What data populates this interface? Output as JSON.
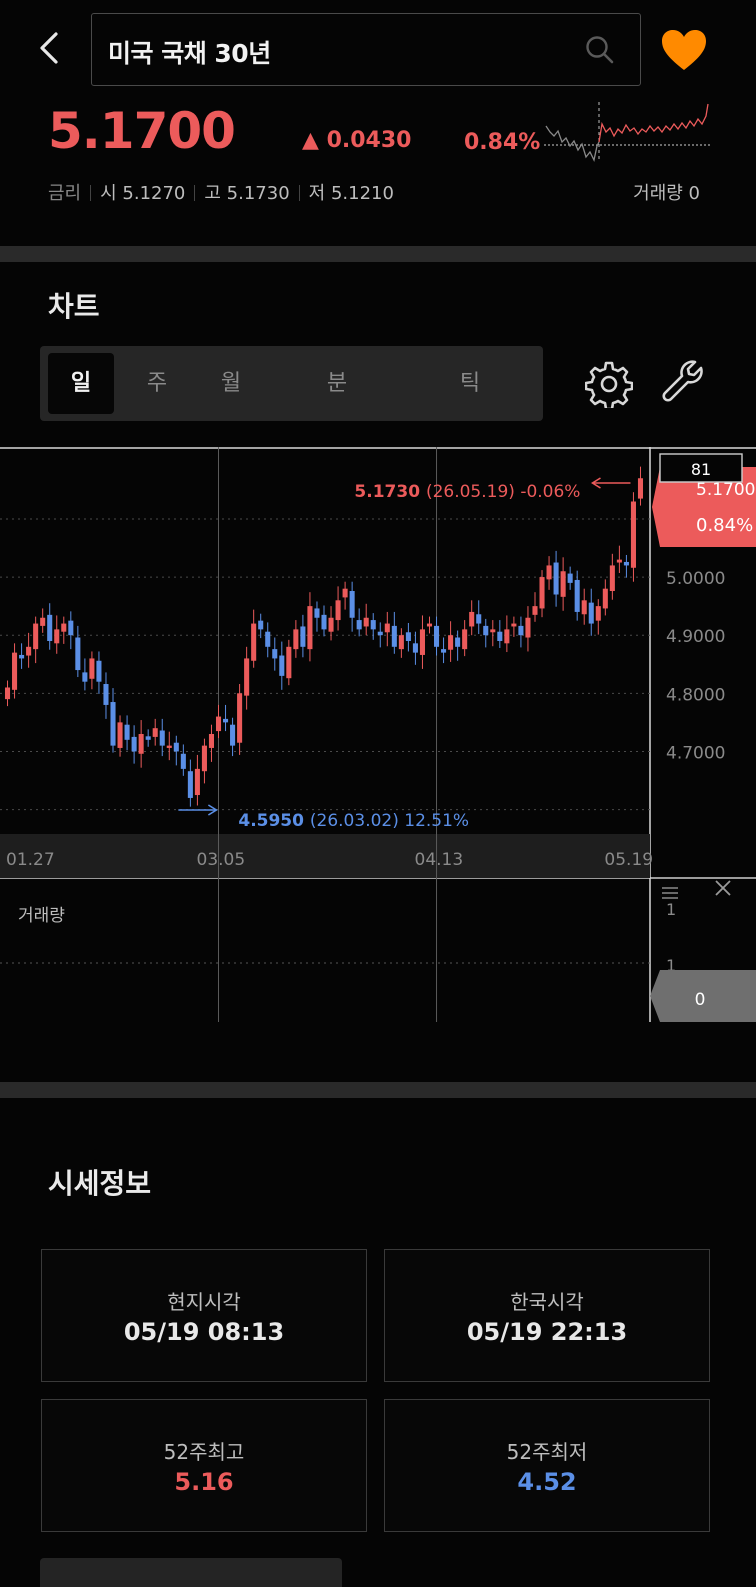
{
  "header": {
    "search_value": "미국 국채 30년",
    "price": "5.1700",
    "change": "▲ 0.0430",
    "change_pct": "0.84%",
    "info": {
      "label": "금리",
      "open": "시 5.1270",
      "high": "고 5.1730",
      "low": "저 5.1210"
    },
    "volume": "거래량 0"
  },
  "chart_section": {
    "title": "차트",
    "tabs": [
      "일",
      "주",
      "월",
      "분",
      "틱"
    ],
    "active_tab": "일"
  },
  "chart_data": {
    "type": "candlestick",
    "x_ticks": [
      "01.27",
      "03.05",
      "04.13",
      "05.19"
    ],
    "y_ticks": [
      "5.0000",
      "4.9000",
      "4.8000",
      "4.7000"
    ],
    "ylim": [
      4.57,
      5.21
    ],
    "high_marker": {
      "price": "5.1730",
      "detail": "(26.05.19) -0.06%"
    },
    "low_marker": {
      "price": "4.5950",
      "detail": "(26.03.02) 12.51%"
    },
    "current_badge": {
      "count": "81",
      "price": "5.1700",
      "pct": "0.84%"
    },
    "closes": [
      4.81,
      4.87,
      4.86,
      4.88,
      4.92,
      4.93,
      4.89,
      4.91,
      4.92,
      4.9,
      4.84,
      4.82,
      4.86,
      4.82,
      4.78,
      4.71,
      4.75,
      4.72,
      4.7,
      4.73,
      4.72,
      4.74,
      4.71,
      4.71,
      4.7,
      4.67,
      4.62,
      4.67,
      4.71,
      4.73,
      4.76,
      4.75,
      4.71,
      4.8,
      4.86,
      4.92,
      4.91,
      4.88,
      4.86,
      4.83,
      4.88,
      4.91,
      4.88,
      4.95,
      4.93,
      4.91,
      4.93,
      4.96,
      4.98,
      4.93,
      4.91,
      4.93,
      4.91,
      4.9,
      4.92,
      4.88,
      4.9,
      4.89,
      4.87,
      4.91,
      4.92,
      4.88,
      4.87,
      4.9,
      4.88,
      4.91,
      4.94,
      4.92,
      4.9,
      4.91,
      4.89,
      4.91,
      4.92,
      4.9,
      4.93,
      4.95,
      5.0,
      5.02,
      4.97,
      5.01,
      4.99,
      4.94,
      4.96,
      4.92,
      4.95,
      4.98,
      5.02,
      5.03,
      5.02,
      5.13,
      5.17
    ],
    "volume_label": "거래량",
    "volume_ticks": [
      "1",
      "1"
    ],
    "volume_value": "0"
  },
  "quote_info": {
    "title": "시세정보",
    "cards": [
      {
        "label": "현지시각",
        "value": "05/19 08:13",
        "tone": ""
      },
      {
        "label": "한국시각",
        "value": "05/19 22:13",
        "tone": ""
      },
      {
        "label": "52주최고",
        "value": "5.16",
        "tone": "up"
      },
      {
        "label": "52주최저",
        "value": "4.52",
        "tone": "down"
      }
    ]
  },
  "colors": {
    "up": "#ec5b5b",
    "down": "#5b8fe6",
    "accent": "#ff8a00"
  }
}
